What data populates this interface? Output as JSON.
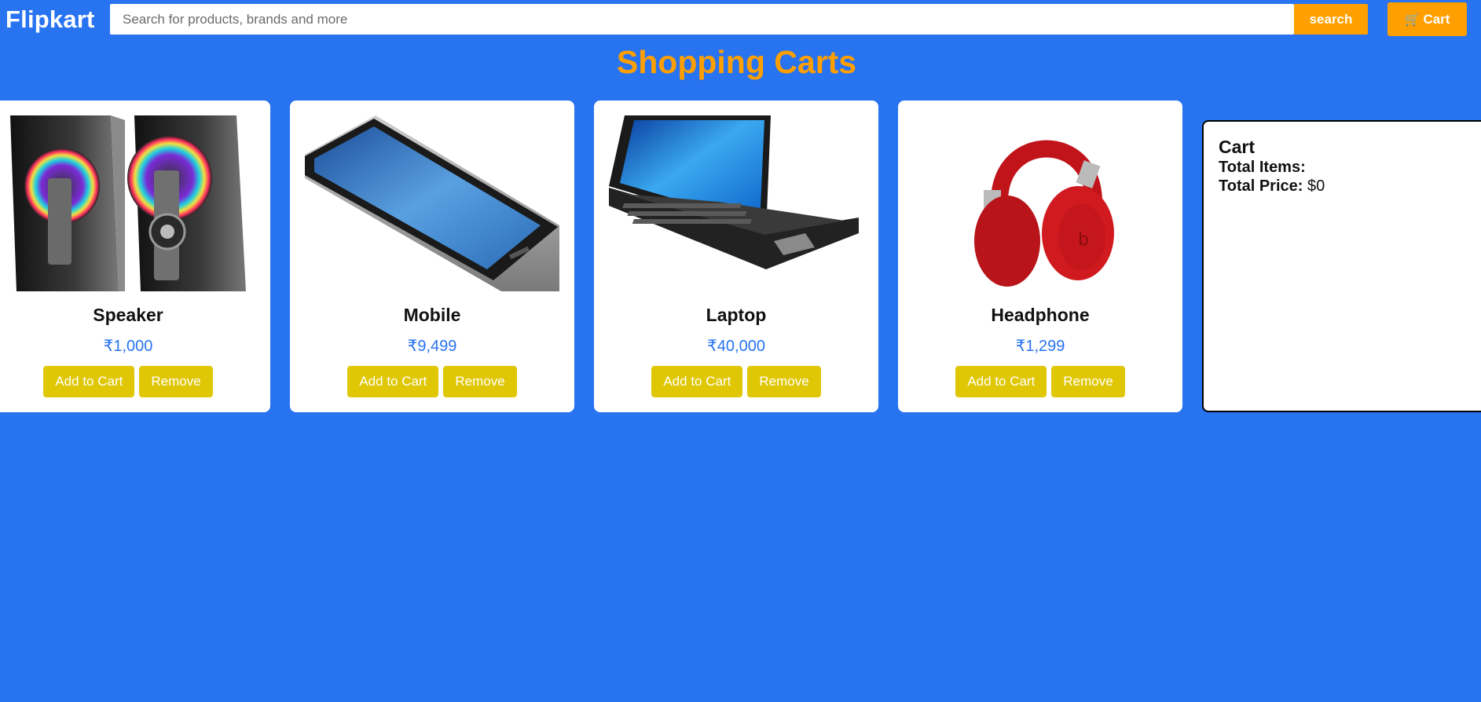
{
  "header": {
    "brand": "Flipkart",
    "search_placeholder": "Search for products, brands and more",
    "search_button": "search",
    "cart_button": "Cart",
    "cart_icon": "shopping-cart-icon"
  },
  "page_title": "Shopping Carts",
  "products": [
    {
      "name": "Speaker",
      "price": "₹1,000",
      "add_label": "Add to Cart",
      "remove_label": "Remove",
      "image": "speaker-image"
    },
    {
      "name": "Mobile",
      "price": "₹9,499",
      "add_label": "Add to Cart",
      "remove_label": "Remove",
      "image": "mobile-image"
    },
    {
      "name": "Laptop",
      "price": "₹40,000",
      "add_label": "Add to Cart",
      "remove_label": "Remove",
      "image": "laptop-image"
    },
    {
      "name": "Headphone",
      "price": "₹1,299",
      "add_label": "Add to Cart",
      "remove_label": "Remove",
      "image": "headphone-image"
    }
  ],
  "cart_panel": {
    "title": "Cart",
    "total_items_label": "Total Items:",
    "total_items_value": "",
    "total_price_label": "Total Price:",
    "total_price_value": "$0"
  },
  "colors": {
    "background": "#2873f0",
    "accent_orange": "#ff9f00",
    "button_yellow": "#e0c706",
    "price_blue": "#2873f0"
  }
}
